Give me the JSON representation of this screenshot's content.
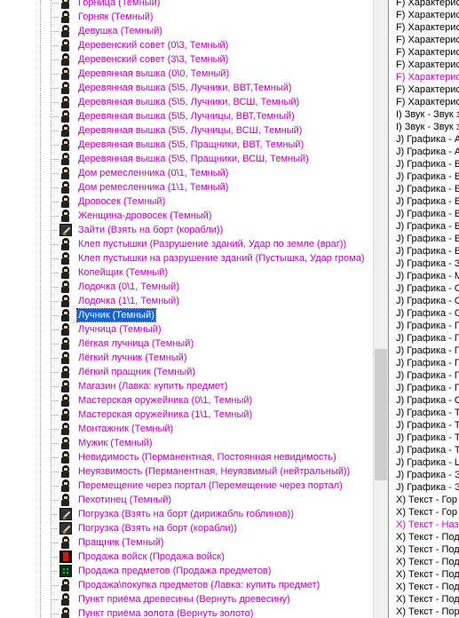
{
  "tree": {
    "items": [
      {
        "label": "Горница (Темный)",
        "icon": "person-icon"
      },
      {
        "label": "Горняк (Темный)",
        "icon": "person-icon"
      },
      {
        "label": "Девушка (Темный)",
        "icon": "person-icon"
      },
      {
        "label": "Деревенский совет (0\\3, Темный)",
        "icon": "person-icon"
      },
      {
        "label": "Деревенский совет (3\\3, Темный)",
        "icon": "person-icon"
      },
      {
        "label": "Деревянная вышка (0\\0, Темный)",
        "icon": "person-icon"
      },
      {
        "label": "Деревянная вышка (5\\5, Лучники, ВВТ,Темный)",
        "icon": "person-icon"
      },
      {
        "label": "Деревянная вышка (5\\5, Лучники, ВСШ, Темный)",
        "icon": "person-icon"
      },
      {
        "label": "Деревянная вышка (5\\5, Лучницы, ВВТ,Темный)",
        "icon": "person-icon"
      },
      {
        "label": "Деревянная вышка (5\\5, Лучницы, ВСШ, Темный)",
        "icon": "person-icon"
      },
      {
        "label": "Деревянная вышка (5\\5, Пращники, ВВТ, Темный)",
        "icon": "person-icon"
      },
      {
        "label": "Деревянная вышка (5\\5, Пращники, ВСШ, Темный)",
        "icon": "person-icon"
      },
      {
        "label": "Дом ремесленника (0\\1, Темный)",
        "icon": "person-icon"
      },
      {
        "label": "Дом ремесленника (1\\1, Темный)",
        "icon": "person-icon"
      },
      {
        "label": "Дровосек (Темный)",
        "icon": "person-icon"
      },
      {
        "label": "Женщина-дровосек (Темный)",
        "icon": "person-icon"
      },
      {
        "label": "Зайти (Взять на борт (корабли))",
        "icon": "sword-icon"
      },
      {
        "label": "Клеп пустышки (Разрушение зданий, Удар по земле (враг))",
        "icon": "person-icon"
      },
      {
        "label": "Клеп пустышки на разрушение зданий (Пустышка, Удар грома)",
        "icon": "person-icon"
      },
      {
        "label": "Копейщик (Темный)",
        "icon": "person-icon"
      },
      {
        "label": "Лодочка (0\\1, Темный)",
        "icon": "person-icon"
      },
      {
        "label": "Лодочка (1\\1, Темный)",
        "icon": "person-icon"
      },
      {
        "label": "Лучник (Темный)",
        "icon": "person-icon",
        "selected": true
      },
      {
        "label": "Лучница (Темный)",
        "icon": "person-icon"
      },
      {
        "label": "Лёгкая лучница (Темный)",
        "icon": "person-icon"
      },
      {
        "label": "Лёгкий лучник (Темный)",
        "icon": "person-icon"
      },
      {
        "label": "Лёгкий пращник (Темный)",
        "icon": "person-icon"
      },
      {
        "label": "Магазин (Лавка: купить предмет)",
        "icon": "person-icon"
      },
      {
        "label": "Мастерская оружейника (0\\1, Темный)",
        "icon": "person-icon"
      },
      {
        "label": "Мастерская оружейника (1\\1, Темный)",
        "icon": "person-icon"
      },
      {
        "label": "Монтажник (Темный)",
        "icon": "person-icon"
      },
      {
        "label": "Мужик (Темный)",
        "icon": "person-icon"
      },
      {
        "label": "Невидимость (Перманентная, Постоянная невидимость)",
        "icon": "person-icon"
      },
      {
        "label": "Неуязвимость (Перманентная, Неуязвимый (нейтральный))",
        "icon": "person-icon"
      },
      {
        "label": "Перемещение через портал (Перемещение через портал)",
        "icon": "person-icon"
      },
      {
        "label": "Пехотинец (Темный)",
        "icon": "person-icon"
      },
      {
        "label": "Погрузка (Взять на борт (дирижабль гоблинов))",
        "icon": "sword-icon"
      },
      {
        "label": "Погрузка (Взять на борт (корабли))",
        "icon": "sword-icon"
      },
      {
        "label": "Пращник (Темный)",
        "icon": "person-icon"
      },
      {
        "label": "Продажа войск (Продажа войск)",
        "icon": "red-figure-icon"
      },
      {
        "label": "Продажа предметов (Продажа предметов)",
        "icon": "green-gem-icon"
      },
      {
        "label": "Продажа\\покупка предметов (Лавка: купить предмет)",
        "icon": "person-icon"
      },
      {
        "label": "Пункт приёма древесины (Вернуть древесину)",
        "icon": "person-icon"
      },
      {
        "label": "Пункт приёма золота (Вернуть золото)",
        "icon": "person-icon"
      }
    ]
  },
  "right_list": {
    "items": [
      {
        "text": "F) Характерис",
        "pink": false
      },
      {
        "text": "F) Характерис",
        "pink": false
      },
      {
        "text": "F) Характерис",
        "pink": false
      },
      {
        "text": "F) Характерис",
        "pink": false
      },
      {
        "text": "F) Характерис",
        "pink": false
      },
      {
        "text": "F) Характерис",
        "pink": false
      },
      {
        "text": "F) Характерис",
        "pink": true
      },
      {
        "text": "F) Характерис",
        "pink": false
      },
      {
        "text": "F) Характерис",
        "pink": false
      },
      {
        "text": "I) Звук - Звук з",
        "pink": false
      },
      {
        "text": "I) Звук - Звук з",
        "pink": false
      },
      {
        "text": "J) Графика - А",
        "pink": false
      },
      {
        "text": "J) Графика - А",
        "pink": false
      },
      {
        "text": "J) Графика - В",
        "pink": false
      },
      {
        "text": "J) Графика - В",
        "pink": false
      },
      {
        "text": "J) Графика - В",
        "pink": false
      },
      {
        "text": "J) Графика - В",
        "pink": false
      },
      {
        "text": "J) Графика - В",
        "pink": false
      },
      {
        "text": "J) Графика - В",
        "pink": false
      },
      {
        "text": "J) Графика - В",
        "pink": false
      },
      {
        "text": "J) Графика - В",
        "pink": false
      },
      {
        "text": "J) Графика - З",
        "pink": false
      },
      {
        "text": "J) Графика - М",
        "pink": false
      },
      {
        "text": "J) Графика - О",
        "pink": false
      },
      {
        "text": "J) Графика - О",
        "pink": false
      },
      {
        "text": "J) Графика - О",
        "pink": false
      },
      {
        "text": "J) Графика - П",
        "pink": false
      },
      {
        "text": "J) Графика - П",
        "pink": false
      },
      {
        "text": "J) Графика - П",
        "pink": false
      },
      {
        "text": "J) Графика - П",
        "pink": false
      },
      {
        "text": "J) Графика - П",
        "pink": false
      },
      {
        "text": "J) Графика - П",
        "pink": false
      },
      {
        "text": "J) Графика - С",
        "pink": false
      },
      {
        "text": "J) Графика - Т",
        "pink": false
      },
      {
        "text": "J) Графика - Т",
        "pink": false
      },
      {
        "text": "J) Графика - Т",
        "pink": false
      },
      {
        "text": "J) Графика - Т",
        "pink": false
      },
      {
        "text": "J) Графика - Ц",
        "pink": false
      },
      {
        "text": "J) Графика - Э",
        "pink": false
      },
      {
        "text": "J) Графика - Э",
        "pink": false
      },
      {
        "text": "X) Текст - Гор",
        "pink": false
      },
      {
        "text": "X) Текст - Гор",
        "pink": false
      },
      {
        "text": "X) Текст - Наз",
        "pink": true
      },
      {
        "text": "X) Текст - Под",
        "pink": false
      },
      {
        "text": "X) Текст - Под",
        "pink": false
      },
      {
        "text": "X) Текст - Под",
        "pink": false
      },
      {
        "text": "X) Текст - Под",
        "pink": false
      },
      {
        "text": "X) Текст - Под",
        "pink": false
      },
      {
        "text": "X) Текст - Под",
        "pink": false
      },
      {
        "text": "X) Текст - Пор",
        "pink": false
      }
    ]
  },
  "colors": {
    "item_text": "#c000c0",
    "selection_bg": "#0a64d8",
    "right_pink": "#d000d0"
  }
}
